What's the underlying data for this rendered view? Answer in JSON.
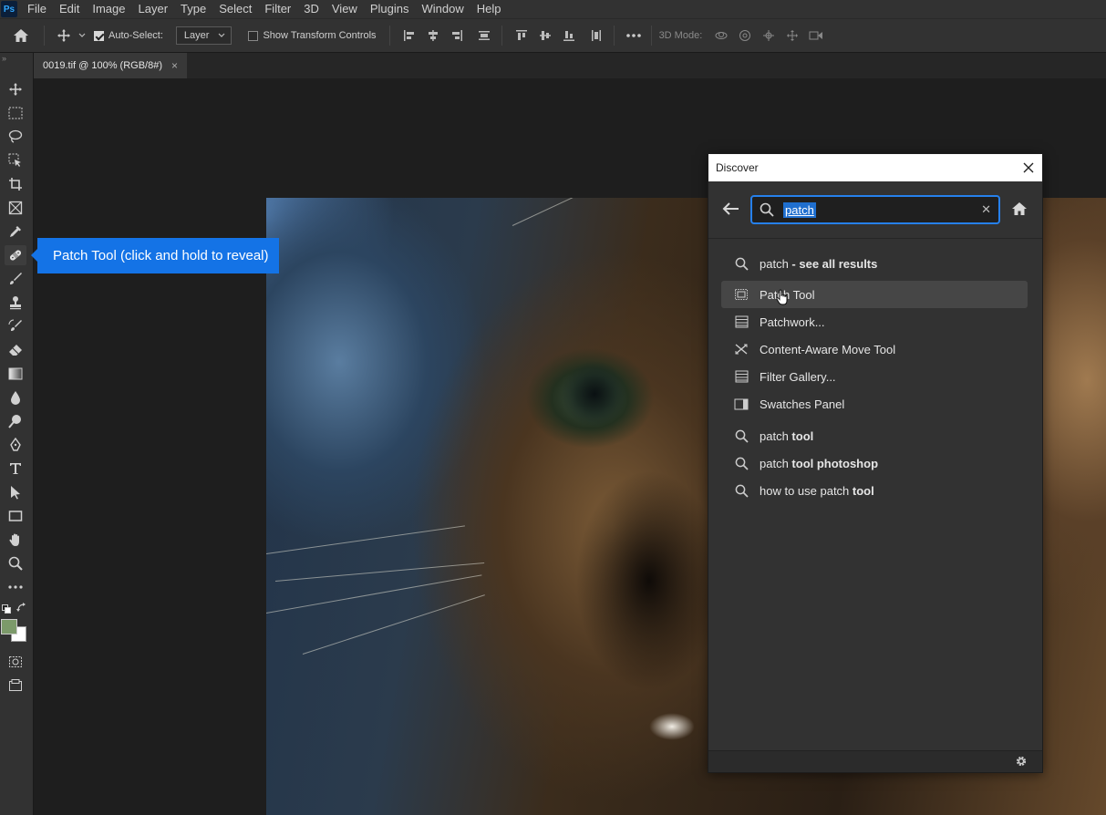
{
  "app": {
    "logo": "Ps"
  },
  "menu": [
    "File",
    "Edit",
    "Image",
    "Layer",
    "Type",
    "Select",
    "Filter",
    "3D",
    "View",
    "Plugins",
    "Window",
    "Help"
  ],
  "options_bar": {
    "auto_select_label": "Auto-Select:",
    "auto_select_checked": true,
    "layer_dropdown": "Layer",
    "show_transform_label": "Show Transform Controls",
    "show_transform_checked": false,
    "mode_3d_label": "3D Mode:"
  },
  "document_tab": {
    "title": "0019.tif @ 100% (RGB/8#)",
    "close": "×"
  },
  "tooltip": {
    "text": "Patch Tool (click and hold to reveal)"
  },
  "colors": {
    "foreground": "#7c9a6a",
    "background": "#ffffff",
    "accent": "#1473e6",
    "search_border": "#2680eb"
  },
  "discover": {
    "title": "Discover",
    "search": {
      "value": "patch"
    },
    "results": [
      {
        "icon": "search-icon",
        "prefix": "patch",
        "bold": " - see all results"
      },
      {
        "icon": "patch-tool-icon",
        "prefix": "",
        "bold": "",
        "text": "Patch Tool",
        "highlighted": true
      },
      {
        "icon": "menu-command-icon",
        "text": "Patchwork..."
      },
      {
        "icon": "content-aware-move-icon",
        "text": "Content-Aware Move Tool"
      },
      {
        "icon": "menu-command-icon",
        "text": "Filter Gallery..."
      },
      {
        "icon": "panel-icon",
        "text": "Swatches Panel"
      },
      {
        "icon": "search-icon",
        "prefix": "patch",
        "bold": " tool"
      },
      {
        "icon": "search-icon",
        "prefix": "patch",
        "bold": " tool photoshop"
      },
      {
        "icon": "search-icon",
        "prefix": "how to use patch",
        "bold": " tool"
      }
    ]
  }
}
